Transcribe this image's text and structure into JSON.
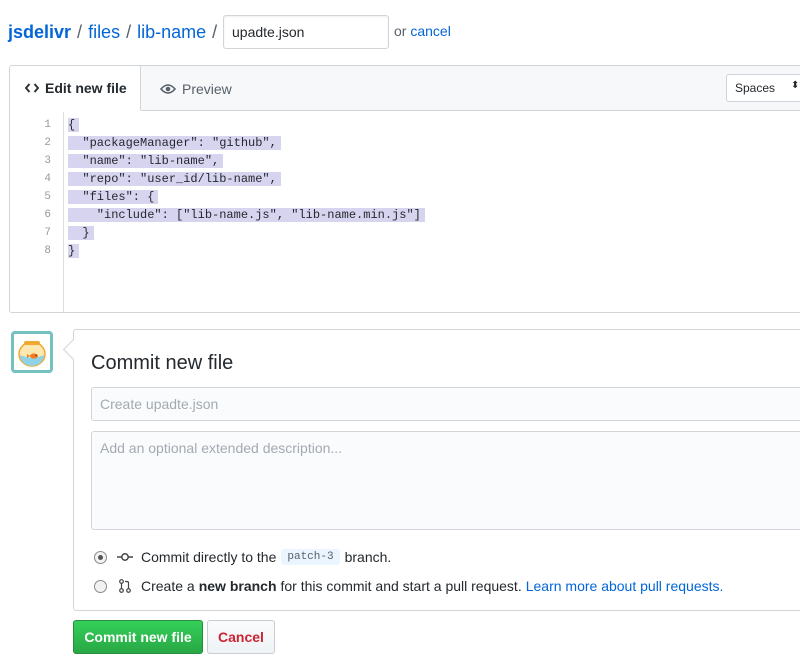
{
  "breadcrumb": {
    "owner": "jsdelivr",
    "sep1": "/",
    "dir1": "files",
    "sep2": "/",
    "dir2": "lib-name",
    "sep3": "/"
  },
  "filename": {
    "value": "upadte.json"
  },
  "or_text": "or",
  "cancel_link": "cancel",
  "editor": {
    "tabs": [
      {
        "label": "Edit new file",
        "icon": "code-icon",
        "active": true
      },
      {
        "label": "Preview",
        "icon": "eye-icon",
        "active": false
      }
    ],
    "indent_mode": "Spaces",
    "lines": [
      {
        "num": "1",
        "text": "{"
      },
      {
        "num": "2",
        "text": "  \"packageManager\": \"github\","
      },
      {
        "num": "3",
        "text": "  \"name\": \"lib-name\","
      },
      {
        "num": "4",
        "text": "  \"repo\": \"user_id/lib-name\","
      },
      {
        "num": "5",
        "text": "  \"files\": {"
      },
      {
        "num": "6",
        "text": "    \"include\": [\"lib-name.js\", \"lib-name.min.js\"]"
      },
      {
        "num": "7",
        "text": "  }"
      },
      {
        "num": "8",
        "text": "}"
      }
    ]
  },
  "commit": {
    "title": "Commit new file",
    "summary_placeholder": "Create upadte.json",
    "description_placeholder": "Add an optional extended description...",
    "option_direct": {
      "before": "Commit directly to the",
      "branch": "patch-3",
      "after": "branch."
    },
    "option_new_branch": {
      "before": "Create a",
      "bold": "new branch",
      "after": "for this commit and start a pull request.",
      "link": "Learn more about pull requests."
    },
    "submit_label": "Commit new file",
    "cancel_label": "Cancel"
  },
  "colors": {
    "link": "#0366d6",
    "selection": "#d7d4f0",
    "commit_button": "#28a745",
    "cancel_text": "#cb2431"
  }
}
